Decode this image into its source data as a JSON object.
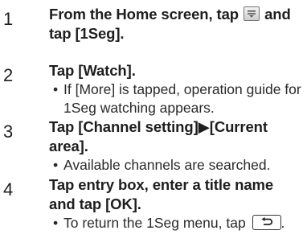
{
  "steps": [
    {
      "number": "1",
      "title_part1": "From the Home screen, tap",
      "title_part2": "and tap [1Seg].",
      "icon": "menu-key-icon"
    },
    {
      "number": "2",
      "title": "Tap [Watch].",
      "note_bullet": "•",
      "note_line1": "If [More] is tapped, operation guide for",
      "note_line2": "1Seg watching appears."
    },
    {
      "number": "3",
      "title_line1": "Tap [Channel setting]▶[Current",
      "title_line2": "area].",
      "note_bullet": "•",
      "note": "Available channels are searched."
    },
    {
      "number": "4",
      "title_line1": "Tap entry box, enter a title name",
      "title_line2": "and tap [OK].",
      "note_bullet": "•",
      "note_part1": "To return the 1Seg menu, tap",
      "note_part2": ".",
      "icon": "back-key-icon"
    }
  ],
  "colors": {
    "text": "#1e1e1e",
    "icon_border": "#333333"
  }
}
